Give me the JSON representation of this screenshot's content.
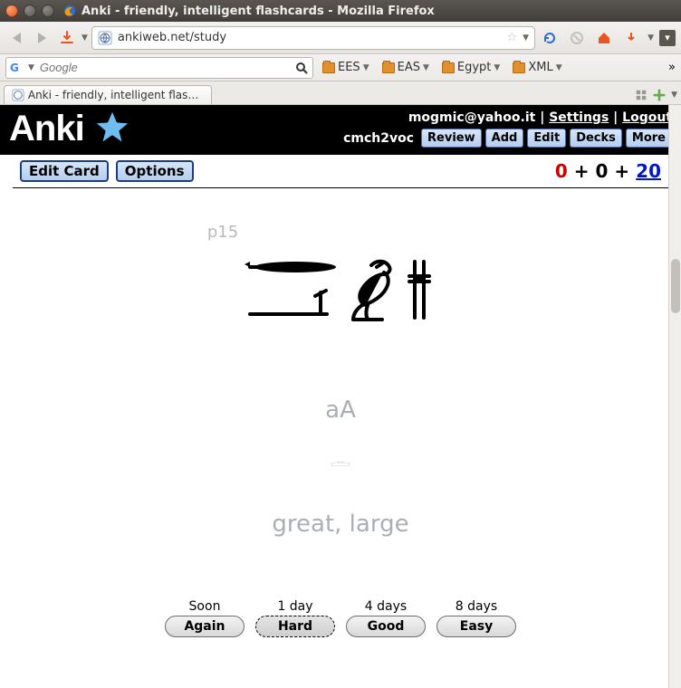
{
  "window": {
    "title": "Anki - friendly, intelligent flashcards - Mozilla Firefox"
  },
  "urlbar": {
    "url": "ankiweb.net/study"
  },
  "searchbar": {
    "placeholder": "Google"
  },
  "bookmarks": [
    {
      "label": "EES"
    },
    {
      "label": "EAS"
    },
    {
      "label": "Egypt"
    },
    {
      "label": "XML"
    }
  ],
  "tab": {
    "title": "Anki - friendly, intelligent flash…"
  },
  "anki": {
    "logo_text": "Anki",
    "user_email": "mogmic@yahoo.it",
    "settings_label": "Settings",
    "logout_label": "Logout",
    "deck_name": "cmch2voc",
    "nav_buttons": {
      "review": "Review",
      "add": "Add",
      "edit": "Edit",
      "decks": "Decks",
      "more": "More"
    }
  },
  "study": {
    "edit_card_label": "Edit Card",
    "options_label": "Options",
    "counts": {
      "new": "0",
      "learn": "0",
      "due": "20",
      "sep": "+"
    },
    "card": {
      "reference": "p15",
      "transliteration": "aA",
      "determinative": "𓏛",
      "meaning": "great, large"
    },
    "answers": [
      {
        "interval": "Soon",
        "label": "Again",
        "selected": false
      },
      {
        "interval": "1 day",
        "label": "Hard",
        "selected": true
      },
      {
        "interval": "4 days",
        "label": "Good",
        "selected": false
      },
      {
        "interval": "8 days",
        "label": "Easy",
        "selected": false
      }
    ]
  }
}
